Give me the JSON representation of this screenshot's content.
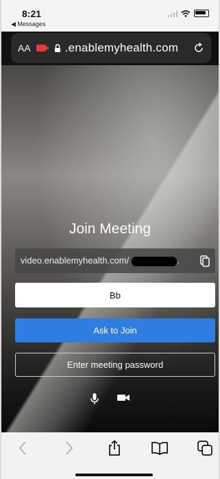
{
  "status": {
    "time": "8:21",
    "back_app": "◀ Messages"
  },
  "address_bar": {
    "text_size": "AA",
    "url": ".enablemyhealth.com"
  },
  "meeting": {
    "title": "Join Meeting",
    "link": "video.enablemyhealth.com/",
    "link_suffix": ".",
    "name_value": "Bb",
    "ask_label": "Ask to Join",
    "password_label": "Enter meeting password"
  },
  "colors": {
    "accent": "#2f7de1",
    "record": "#e53935",
    "address_bg": "#2a2a2a"
  },
  "icons": [
    "microphone-icon",
    "video-camera-icon",
    "copy-icon",
    "lock-icon",
    "reload-icon",
    "back-icon",
    "forward-icon",
    "share-icon",
    "bookmarks-icon",
    "tabs-icon"
  ]
}
